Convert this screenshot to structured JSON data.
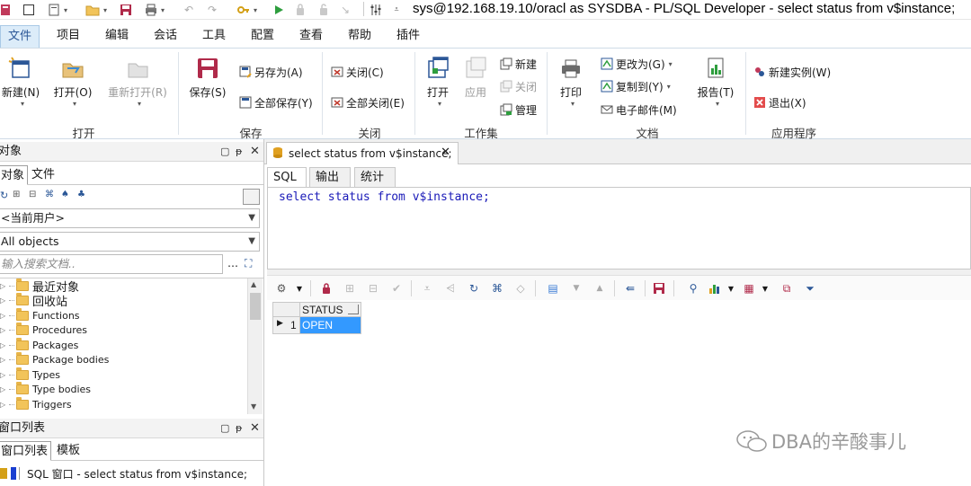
{
  "window": {
    "title": "sys@192.168.19.10/oracl as SYSDBA - PL/SQL Developer - select status from v$instance;"
  },
  "menu": {
    "tabs": [
      "文件",
      "项目",
      "编辑",
      "会话",
      "工具",
      "配置",
      "查看",
      "帮助",
      "插件"
    ],
    "active": "文件"
  },
  "ribbon": {
    "groups": {
      "open": "打开",
      "save": "保存",
      "close": "关闭",
      "workset": "工作集",
      "document": "文档",
      "app": "应用程序"
    },
    "buttons": {
      "new": "新建(N)",
      "open": "打开(O)",
      "reopen": "重新打开(R)",
      "save": "保存(S)",
      "save_as": "另存为(A)",
      "save_all": "全部保存(Y)",
      "close": "关闭(C)",
      "close_all": "全部关闭(E)",
      "ws_open": "打开",
      "ws_apply": "应用",
      "ws_new": "新建",
      "ws_close": "关闭",
      "ws_manage": "管理",
      "print": "打印",
      "change_to": "更改为(G)",
      "copy_to": "复制到(Y)",
      "email": "电子邮件(M)",
      "report": "报告(T)",
      "new_instance": "新建实例(W)",
      "exit": "退出(X)"
    }
  },
  "objects_panel": {
    "title": "对象",
    "tabs": [
      "对象",
      "文件"
    ],
    "user_combo": "<当前用户>",
    "filter_combo": "All objects",
    "search_placeholder": "输入搜索文档..",
    "tree": [
      "最近对象",
      "回收站",
      "Functions",
      "Procedures",
      "Packages",
      "Package bodies",
      "Types",
      "Type bodies",
      "Triggers"
    ]
  },
  "window_list_panel": {
    "title": "窗口列表",
    "tabs": [
      "窗口列表",
      "模板"
    ],
    "items": [
      "SQL 窗口 - select status from v$instance;"
    ]
  },
  "editor": {
    "doc_tab": "select status from v$instance;",
    "sub_tabs": [
      "SQL",
      "输出",
      "统计"
    ],
    "active_sub_tab": "SQL",
    "sql": "select status from v$instance;"
  },
  "result_grid": {
    "columns": [
      "STATUS"
    ],
    "rows": [
      {
        "num": "1",
        "cells": [
          "OPEN"
        ]
      }
    ]
  },
  "watermark": "DBA的辛酸事儿",
  "colors": {
    "accent": "#2b5797",
    "selection": "#3399ff",
    "sql_keyword": "#1a1ab8"
  }
}
